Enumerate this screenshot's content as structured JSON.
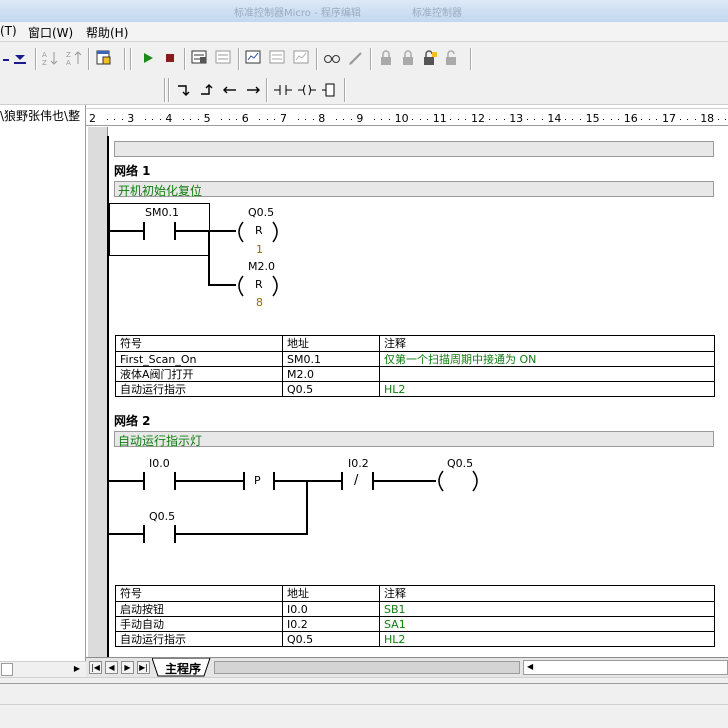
{
  "window": {
    "title_fragments": [
      "标准控制器Micro - 程序编辑",
      "标准控制器"
    ]
  },
  "menu": {
    "items": [
      "(T)",
      "窗口(W)",
      "帮助(H)"
    ]
  },
  "tree": {
    "path_label": "\\狼野张伟也\\整"
  },
  "ruler": {
    "ticks": [
      "2",
      "3",
      "4",
      "5",
      "6",
      "7",
      "8",
      "9",
      "10",
      "11",
      "12",
      "13",
      "14",
      "15",
      "16",
      "17",
      "18"
    ]
  },
  "network1": {
    "title": "网络 1",
    "comment": "开机初始化复位",
    "contact": "SM0.1",
    "coil1": {
      "address": "Q0.5",
      "op": "R",
      "count": "1"
    },
    "coil2": {
      "address": "M2.0",
      "op": "R",
      "count": "8"
    },
    "symbols": {
      "headers": [
        "符号",
        "地址",
        "注释"
      ],
      "rows": [
        {
          "symbol": "First_Scan_On",
          "address": "SM0.1",
          "comment": "仅第一个扫描周期中接通为 ON"
        },
        {
          "symbol": "液体A阀门打开",
          "address": "M2.0",
          "comment": ""
        },
        {
          "symbol": "自动运行指示",
          "address": "Q0.5",
          "comment": "HL2"
        }
      ]
    }
  },
  "network2": {
    "title": "网络 2",
    "comment": "自动运行指示灯",
    "contact1": "I0.0",
    "edge": "P",
    "contact2": "I0.2",
    "nc_mark": "/",
    "coil": "Q0.5",
    "branch_contact": "Q0.5",
    "symbols": {
      "headers": [
        "符号",
        "地址",
        "注释"
      ],
      "rows": [
        {
          "symbol": "启动按钮",
          "address": "I0.0",
          "comment": "SB1"
        },
        {
          "symbol": "手动自动",
          "address": "I0.2",
          "comment": "SA1"
        },
        {
          "symbol": "自动运行指示",
          "address": "Q0.5",
          "comment": "HL2"
        }
      ]
    }
  },
  "tabs": {
    "main": "主程序"
  }
}
